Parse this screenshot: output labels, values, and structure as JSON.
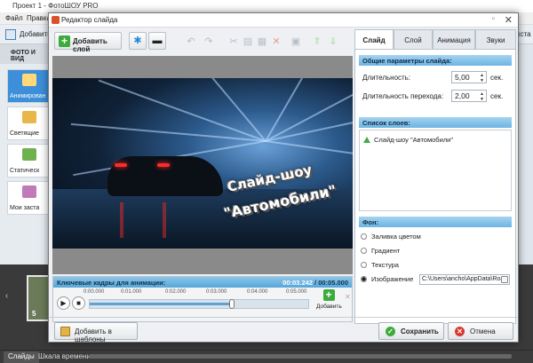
{
  "background_app": {
    "title": "Проект 1 - ФотоШОУ PRO",
    "menu": [
      "Файл",
      "Правка"
    ],
    "toolbar_button": "Добавить",
    "left_header": "ФОТО И ВИД",
    "side_items": [
      "Анимирован",
      "Светящие",
      "Статическ",
      "Мои заста"
    ],
    "right_toolbar_fragment": "кста",
    "slide_number": "5",
    "bottom_tabs": [
      "Слайды",
      "Шкала времени"
    ]
  },
  "dialog": {
    "title": "Редактор слайда",
    "add_layer_label": "Добавить слой",
    "preview_caption_line1": "Слайд-шоу",
    "preview_caption_line2": "\"Автомобили\"",
    "keyframes": {
      "title": "Ключевые кадры для анимации:",
      "time_current": "00:03.242",
      "time_total": "/ 00:05.000",
      "ticks": [
        "0:00.000",
        "0:01.000",
        "0:02.000",
        "0:03.000",
        "0:04.000",
        "0:05.000"
      ],
      "position": 0.65,
      "add_label": "Добавить"
    },
    "tabs": [
      "Слайд",
      "Слой",
      "Анимация",
      "Звуки"
    ],
    "active_tab": "Слайд",
    "general": {
      "title": "Общие параметры слайда:",
      "duration_label": "Длительность:",
      "duration_value": "5,00",
      "transition_label": "Длительность перехода:",
      "transition_value": "2,00",
      "unit": "сек."
    },
    "layers": {
      "title": "Список слоев:",
      "items": [
        "Слайд-шоу \"Автомобили\""
      ]
    },
    "background": {
      "title": "Фон:",
      "options": [
        "Заливка цветом",
        "Градиент",
        "Текстура",
        "Изображение"
      ],
      "selected": "Изображение",
      "image_path": "C:\\Users\\ancho\\AppData\\Roar"
    },
    "footer": {
      "add_template_label": "Добавить в шаблоны",
      "save_label": "Сохранить",
      "cancel_label": "Отмена"
    }
  },
  "colors": {
    "accent_blue": "#56a6d8",
    "ok_green": "#3cab3c",
    "cancel_red": "#d63a2f",
    "selected_side": "#3c8fd8"
  }
}
